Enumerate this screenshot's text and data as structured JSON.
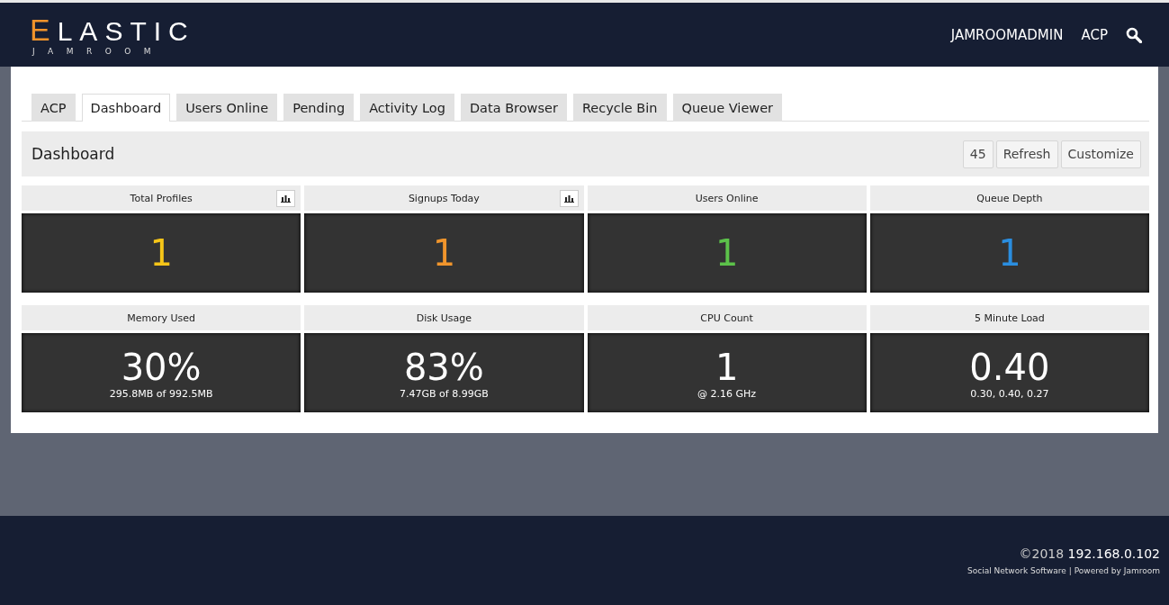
{
  "logo": {
    "first": "E",
    "rest": "LASTIC",
    "sub": "JAMROOM"
  },
  "nav": [
    "JAMROOMADMIN",
    "ACP"
  ],
  "tabs": [
    {
      "label": "ACP",
      "selected": false
    },
    {
      "label": "Dashboard",
      "selected": true
    },
    {
      "label": "Users Online",
      "selected": false
    },
    {
      "label": "Pending",
      "selected": false
    },
    {
      "label": "Activity Log",
      "selected": false
    },
    {
      "label": "Data Browser",
      "selected": false
    },
    {
      "label": "Recycle Bin",
      "selected": false
    },
    {
      "label": "Queue Viewer",
      "selected": false
    }
  ],
  "panel": {
    "title": "Dashboard",
    "buttons": [
      "45",
      "Refresh",
      "Customize"
    ]
  },
  "tile_rows": [
    [
      {
        "title": "Total Profiles",
        "value": "1",
        "color": "#f5c518",
        "chart_button": true
      },
      {
        "title": "Signups Today",
        "value": "1",
        "color": "#f0952c",
        "chart_button": true
      },
      {
        "title": "Users Online",
        "value": "1",
        "color": "#5cc24a",
        "chart_button": false
      },
      {
        "title": "Queue Depth",
        "value": "1",
        "color": "#2a8ee0",
        "chart_button": false
      }
    ],
    [
      {
        "title": "Memory Used",
        "value": "30%",
        "sub": "295.8MB of 992.5MB",
        "color": "#ffffff",
        "chart_button": false
      },
      {
        "title": "Disk Usage",
        "value": "83%",
        "sub": "7.47GB of 8.99GB",
        "color": "#ffffff",
        "chart_button": false
      },
      {
        "title": "CPU Count",
        "value": "1",
        "sub": "@ 2.16 GHz",
        "color": "#ffffff",
        "chart_button": false
      },
      {
        "title": "5 Minute Load",
        "value": "0.40",
        "sub": "0.30, 0.40, 0.27",
        "color": "#ffffff",
        "chart_button": false
      }
    ]
  ],
  "footer": {
    "copyright": "©2018",
    "host": "192.168.0.102",
    "links": [
      "Social Network Software",
      "Powered by Jamroom"
    ],
    "separator": "|"
  }
}
